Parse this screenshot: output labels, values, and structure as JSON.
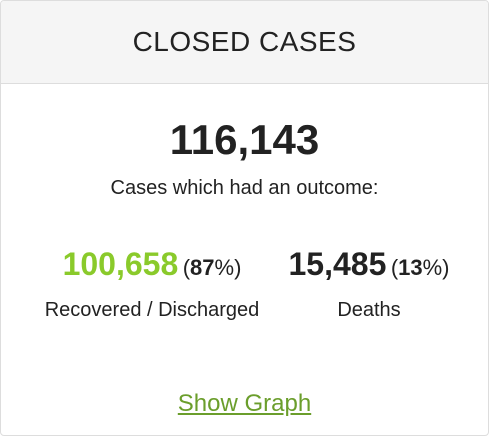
{
  "header": {
    "title": "CLOSED CASES"
  },
  "summary": {
    "total": "116,143",
    "subtitle": "Cases which had an outcome:"
  },
  "recovered": {
    "count": "100,658",
    "percent": "87",
    "label": "Recovered / Discharged",
    "color": "#8ACA2B"
  },
  "deaths": {
    "count": "15,485",
    "percent": "13",
    "label": "Deaths"
  },
  "actions": {
    "show_graph_label": "Show Graph",
    "link_color": "#6B9E2C"
  }
}
